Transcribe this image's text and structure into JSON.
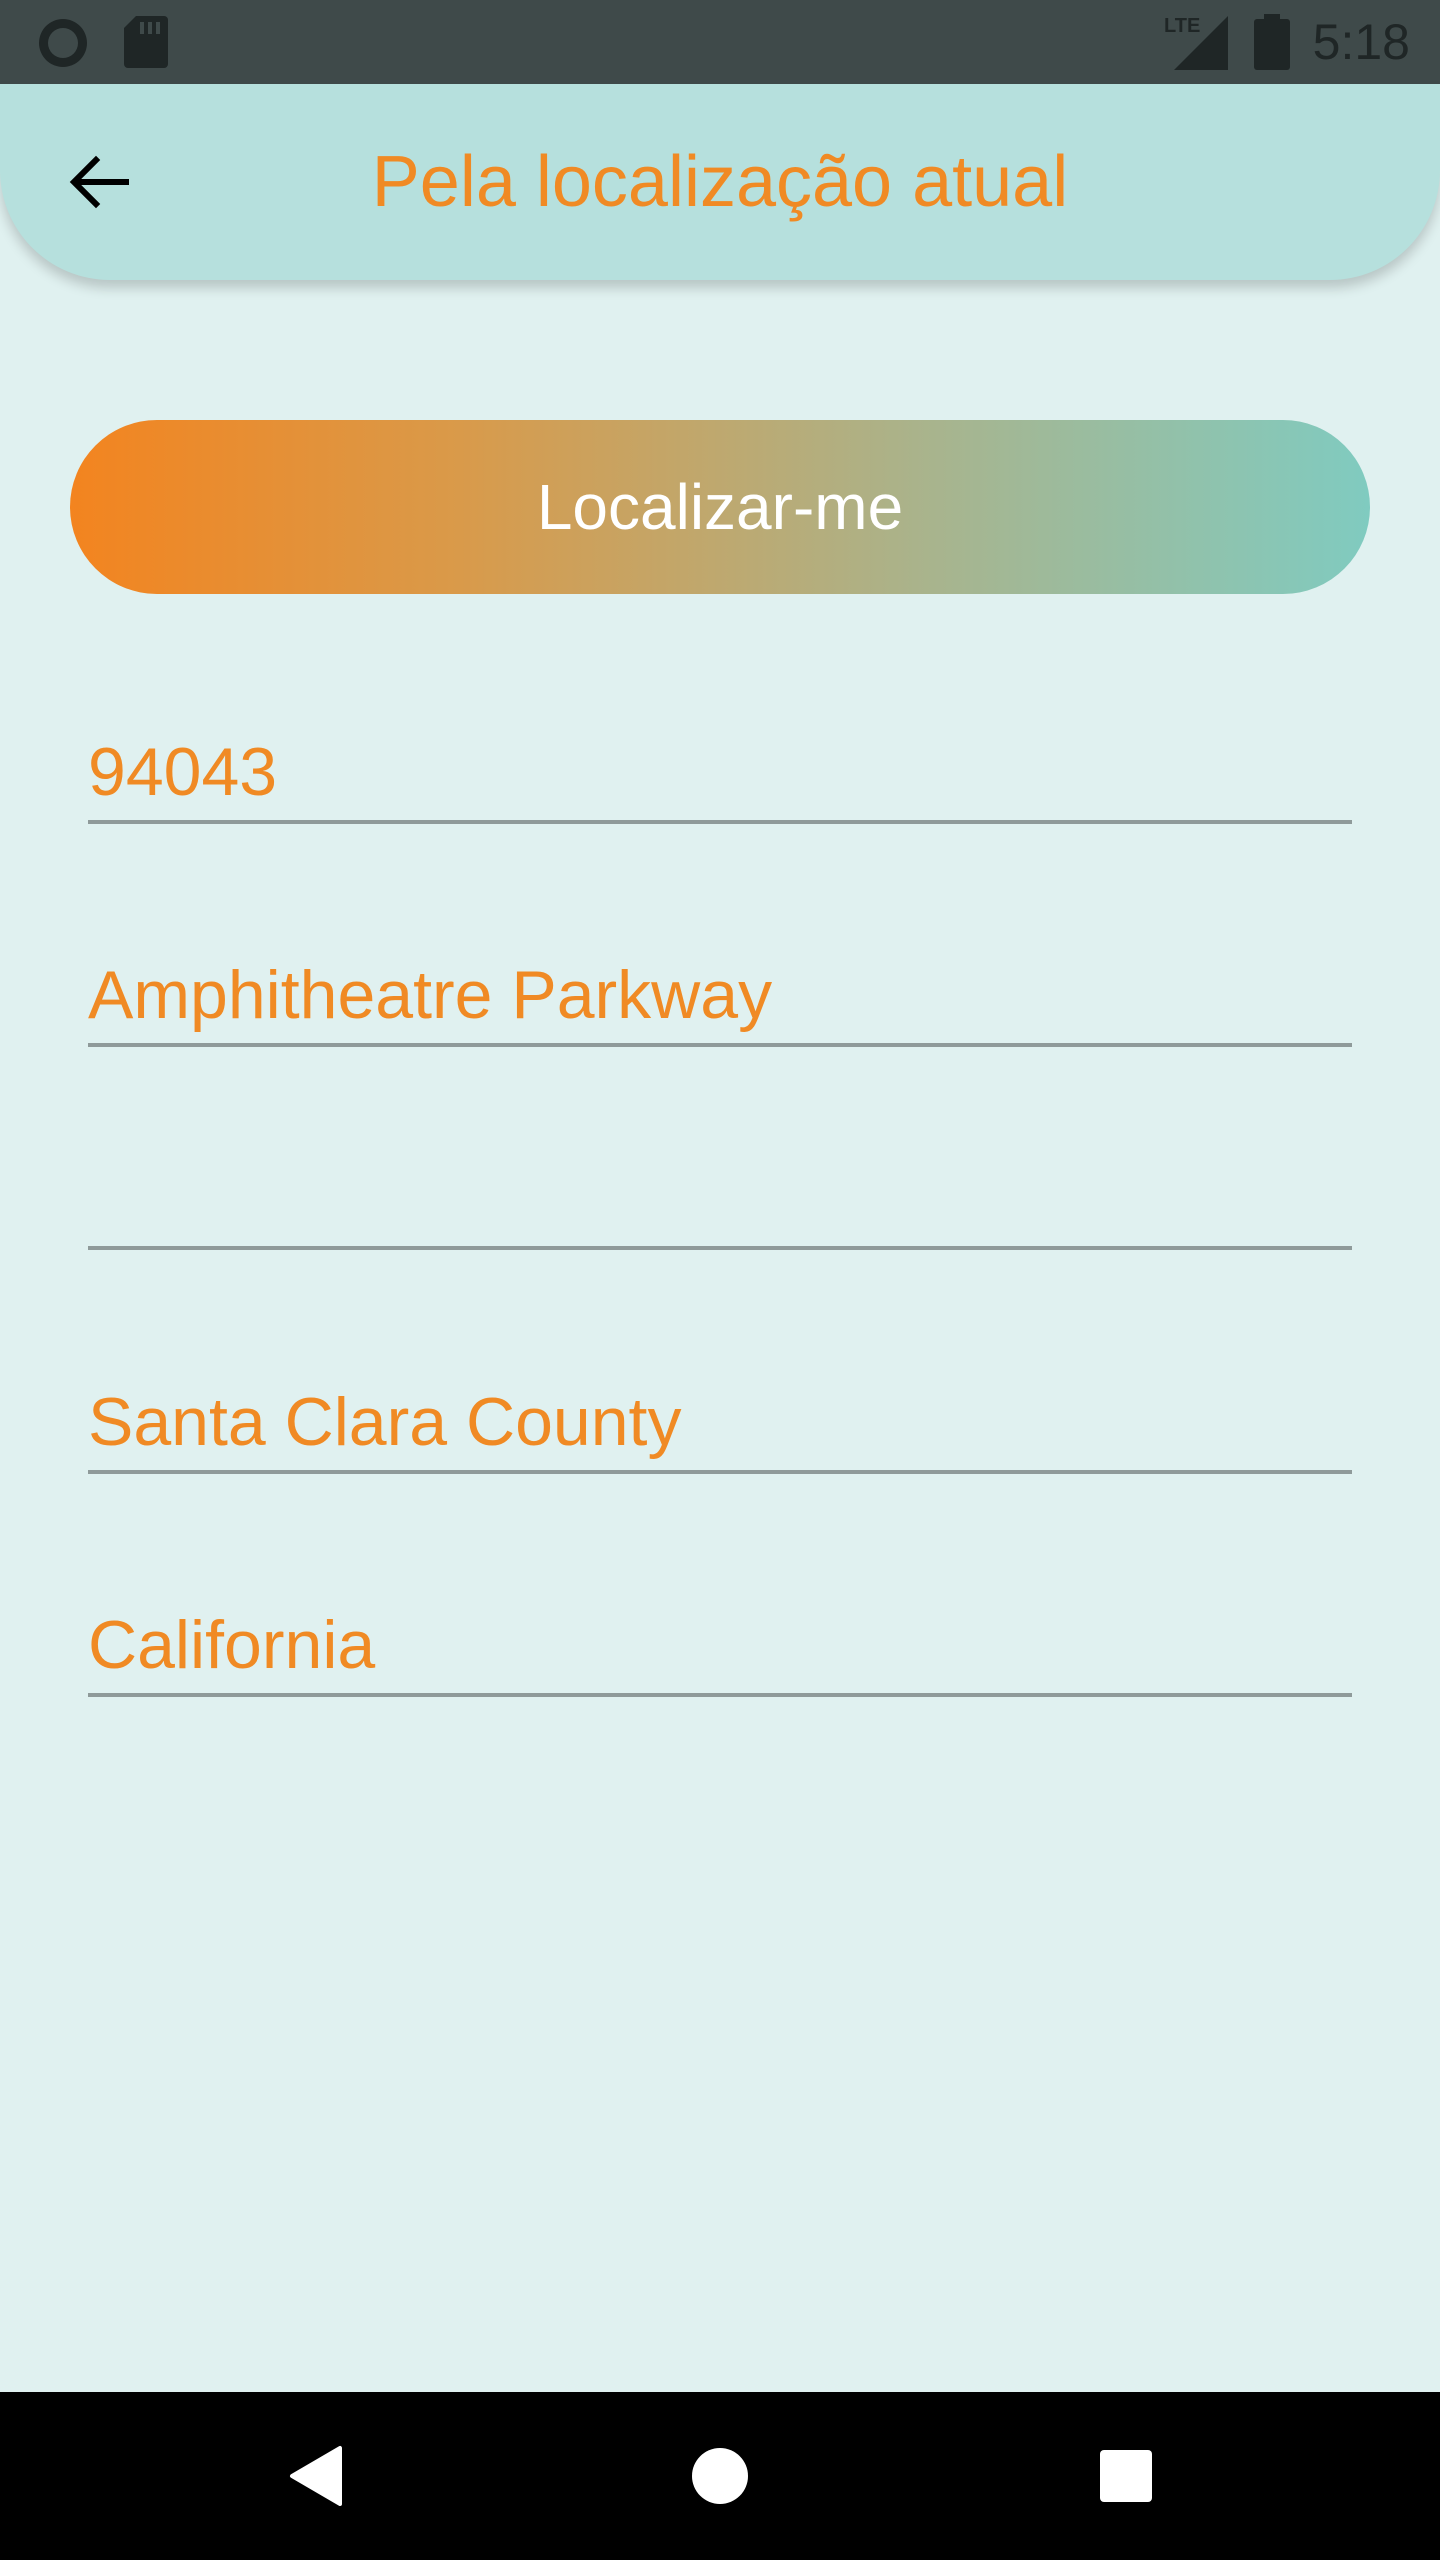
{
  "status_bar": {
    "time": "5:18",
    "network": "LTE",
    "icons": [
      "record-icon",
      "sd-card-icon",
      "lte-signal-icon",
      "battery-icon"
    ]
  },
  "app_bar": {
    "title": "Pela localização atual",
    "back_icon": "arrow-back-icon"
  },
  "locate_button": {
    "label": "Localizar-me"
  },
  "fields": {
    "postal_code": "94043",
    "street": "Amphitheatre Parkway",
    "number": "",
    "county": "Santa Clara County",
    "state": "California"
  },
  "nav": {
    "icons": [
      "back-triangle-icon",
      "home-circle-icon",
      "recents-square-icon"
    ]
  },
  "colors": {
    "accent": "#f08a24",
    "app_bar": "#b6e0dd",
    "background": "#e0f1f0",
    "gradient_start": "#f3841f",
    "gradient_end": "#80cbc0"
  }
}
